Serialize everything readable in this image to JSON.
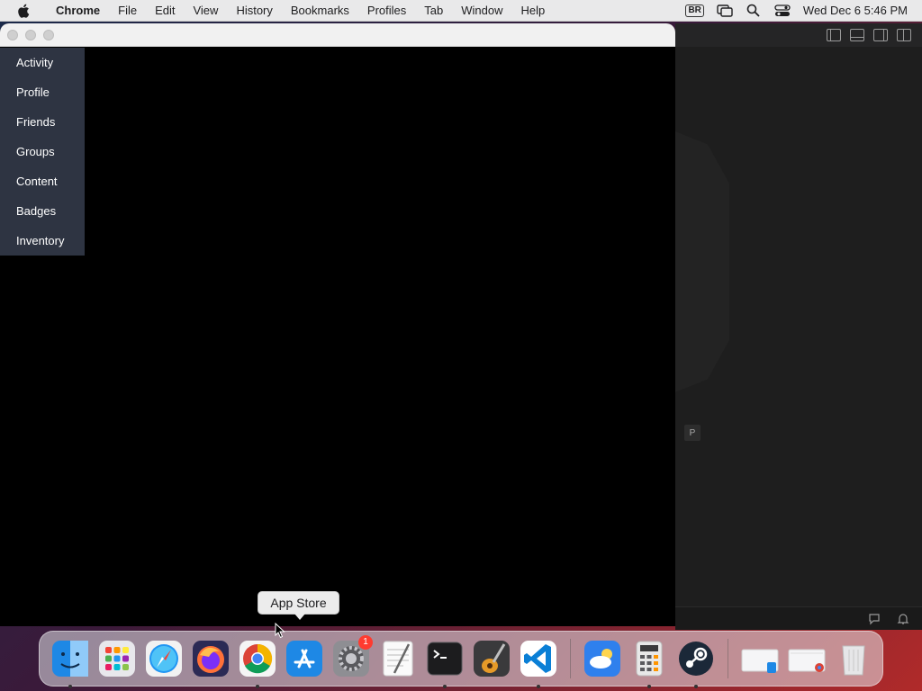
{
  "menubar": {
    "app_name": "Chrome",
    "items": [
      "File",
      "Edit",
      "View",
      "History",
      "Bookmarks",
      "Profiles",
      "Tab",
      "Window",
      "Help"
    ],
    "input_badge": "BR",
    "clock": "Wed Dec 6  5:46 PM"
  },
  "side_menu": {
    "items": [
      "Activity",
      "Profile",
      "Friends",
      "Groups",
      "Content",
      "Badges",
      "Inventory"
    ]
  },
  "background_window": {
    "panel_badge": "P"
  },
  "dock": {
    "tooltip": "App Store",
    "settings_badge": "1",
    "apps": [
      "Finder",
      "Launchpad",
      "Safari",
      "Firefox",
      "Google Chrome",
      "App Store",
      "System Settings",
      "TextEdit",
      "Terminal",
      "GarageBand",
      "Visual Studio Code",
      "Weather",
      "Calculator",
      "Steam",
      "Downloads",
      "Chrome Window",
      "Trash"
    ]
  },
  "colors": {
    "side_menu_bg": "#2e3442",
    "window_bg": "#000000",
    "dark_app_bg": "#1e1e1e",
    "badge_red": "#ff3b30"
  }
}
